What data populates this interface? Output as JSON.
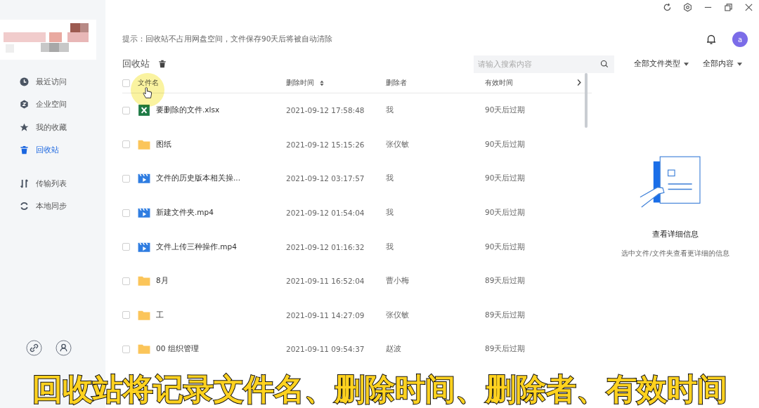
{
  "sidebar": {
    "groups": [
      [
        {
          "label": "最近访问",
          "kind": "clock",
          "selected": false
        },
        {
          "label": "企业空间",
          "kind": "enterprise",
          "selected": false
        },
        {
          "label": "我的收藏",
          "kind": "star",
          "selected": false
        },
        {
          "label": "回收站",
          "kind": "trash",
          "selected": true
        }
      ],
      [
        {
          "label": "传输列表",
          "kind": "transfer",
          "selected": false
        },
        {
          "label": "本地同步",
          "kind": "sync",
          "selected": false
        }
      ]
    ]
  },
  "hint": "提示：回收站不占用网盘空间，文件保存90天后将被自动清除",
  "avatar": "a",
  "title": "回收站",
  "search": {
    "placeholder": "请输入搜索内容"
  },
  "filters": [
    "全部文件类型",
    "全部内容"
  ],
  "table": {
    "select_all_checked": false,
    "columns": [
      {
        "label": "文件名",
        "sortable": false
      },
      {
        "label": "删除时间",
        "sortable": true
      },
      {
        "label": "删除者",
        "sortable": false
      },
      {
        "label": "有效时间",
        "sortable": false
      }
    ],
    "rows": [
      {
        "name": "要删除的文件.xlsx",
        "kind": "excel",
        "time": "2021-09-12 17:58:48",
        "deleter": "我",
        "expiry": "90天后过期",
        "checked": false
      },
      {
        "name": "图纸",
        "kind": "folder",
        "time": "2021-09-12 15:15:26",
        "deleter": "张仪敏",
        "expiry": "90天后过期",
        "checked": false
      },
      {
        "name": "文件的历史版本相关操...",
        "kind": "video",
        "time": "2021-09-12 03:17:57",
        "deleter": "我",
        "expiry": "90天后过期",
        "checked": false
      },
      {
        "name": "新建文件夹.mp4",
        "kind": "video",
        "time": "2021-09-12 01:54:04",
        "deleter": "我",
        "expiry": "90天后过期",
        "checked": false
      },
      {
        "name": "文件上传三种操作.mp4",
        "kind": "video",
        "time": "2021-09-12 01:16:32",
        "deleter": "我",
        "expiry": "90天后过期",
        "checked": false
      },
      {
        "name": "8月",
        "kind": "folder",
        "time": "2021-09-11 16:52:04",
        "deleter": "曹小梅",
        "expiry": "89天后过期",
        "checked": false
      },
      {
        "name": "工",
        "kind": "folder",
        "time": "2021-09-11 14:27:09",
        "deleter": "张仪敏",
        "expiry": "89天后过期",
        "checked": false
      },
      {
        "name": "00 组织管理",
        "kind": "folder",
        "time": "2021-09-11 09:54:37",
        "deleter": "赵波",
        "expiry": "89天后过期",
        "checked": false
      }
    ]
  },
  "details": {
    "title": "查看详细信息",
    "hint": "选中文件/文件夹查看更详细的信息"
  },
  "caption": "回收站将记录文件名、删除时间、删除者、有效时间"
}
